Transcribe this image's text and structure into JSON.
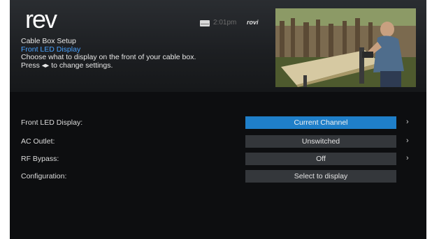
{
  "header": {
    "logo_text": "rev",
    "time": "2:01pm",
    "brand": "rovi",
    "title": "Cable Box Setup",
    "subtitle": "Front LED Display",
    "description": "Choose what to display on the front of your cable box.",
    "hint": "Press ◂▸ to change settings."
  },
  "settings": [
    {
      "label": "Front LED Display:",
      "value": "Current Channel",
      "selected": true,
      "has_arrow": true
    },
    {
      "label": "AC Outlet:",
      "value": "Unswitched",
      "selected": false,
      "has_arrow": true
    },
    {
      "label": "RF Bypass:",
      "value": "Off",
      "selected": false,
      "has_arrow": true
    },
    {
      "label": "Configuration:",
      "value": "Select to display",
      "selected": false,
      "has_arrow": false
    }
  ],
  "arrow_glyph": "›",
  "icons": {
    "mail": "mail-icon",
    "chevron": "chevron-right-icon"
  },
  "colors": {
    "accent_blue": "#1f7fc9",
    "subtitle_blue": "#4aa3ff",
    "row_bg": "#34373b",
    "screen_bg": "#0d0e10"
  }
}
